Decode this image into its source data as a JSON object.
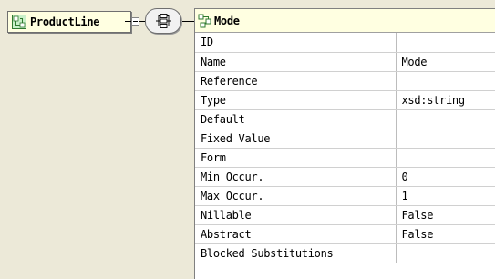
{
  "element": {
    "name": "ProductLine",
    "icon": "element-icon"
  },
  "compositor": {
    "kind": "sequence",
    "icon": "sequence-icon"
  },
  "properties_panel": {
    "title": "Mode",
    "icon": "attribute-icon",
    "rows": [
      {
        "key": "ID",
        "value": ""
      },
      {
        "key": "Name",
        "value": "Mode"
      },
      {
        "key": "Reference",
        "value": ""
      },
      {
        "key": "Type",
        "value": "xsd:string"
      },
      {
        "key": "Default",
        "value": ""
      },
      {
        "key": "Fixed Value",
        "value": ""
      },
      {
        "key": "Form",
        "value": ""
      },
      {
        "key": "Min Occur.",
        "value": "0"
      },
      {
        "key": "Max Occur.",
        "value": "1"
      },
      {
        "key": "Nillable",
        "value": "False"
      },
      {
        "key": "Abstract",
        "value": "False"
      },
      {
        "key": "Blocked Substitutions",
        "value": ""
      }
    ]
  },
  "colors": {
    "background": "#ece9d8",
    "node_fill": "#ffffe1",
    "icon_green": "#3a8a3a"
  }
}
